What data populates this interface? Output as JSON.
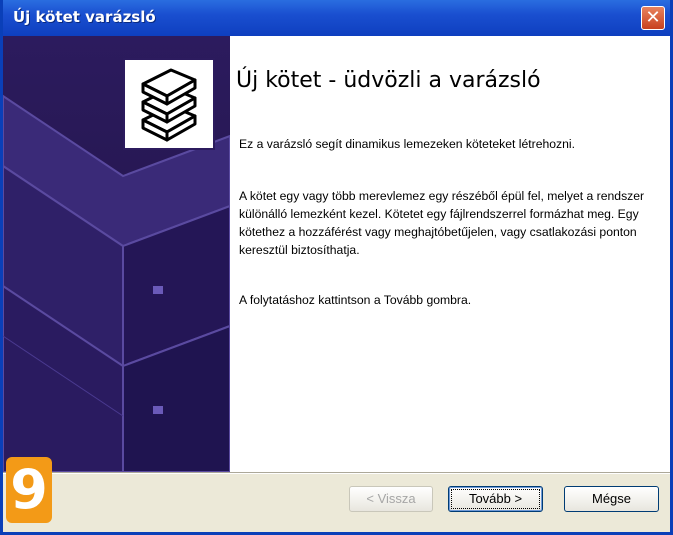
{
  "window": {
    "title": "Új kötet varázsló",
    "close_icon": "close-icon"
  },
  "wizard": {
    "heading": "Új kötet - üdvözli a varázsló",
    "paragraph1": "Ez a varázsló segít dinamikus lemezeken köteteket létrehozni.",
    "paragraph2": "A kötet egy vagy több merevlemez egy részéből épül fel, melyet a rendszer különálló lemezként kezel. Kötetet egy fájlrendszerrel formázhat meg. Egy kötethez a hozzáférést vagy meghajtóbetűjelen, vagy csatlakozási ponton keresztül biztosíthatja.",
    "paragraph3": "A folytatáshoz kattintson a Tovább gombra."
  },
  "buttons": {
    "back_label": "< Vissza",
    "next_label": "Tovább >",
    "cancel_label": "Mégse"
  },
  "step_badge": "9",
  "icons": {
    "wizard_icon": "stacked-disks-icon",
    "side_art": "disk-volumes-graphic"
  }
}
